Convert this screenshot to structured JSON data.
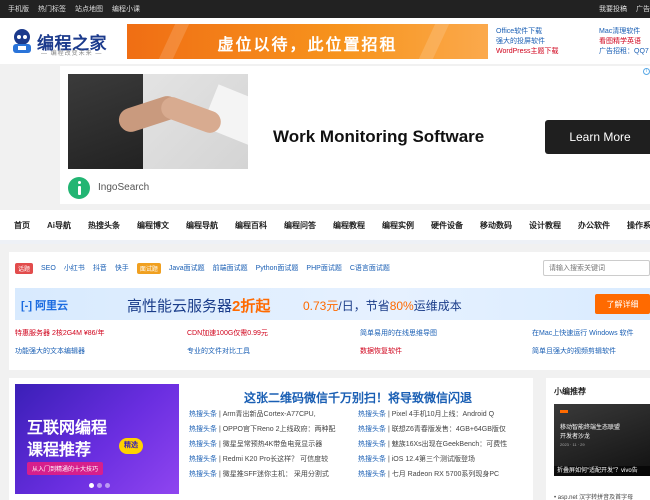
{
  "colors": {
    "brand": "#1b3a8c",
    "link": "#1a5fb4",
    "accent": "#f7941d",
    "red": "#d0021b"
  },
  "topbar": {
    "left": [
      "手机版",
      "热门标签",
      "站点地图",
      "编程小课"
    ],
    "right": [
      "我要投稿",
      "广告"
    ]
  },
  "header": {
    "logo_name": "编程之家",
    "logo_slogan": "— 编程改变未来 —",
    "banner_text": "虚位以待，此位置招租",
    "links_col1": [
      "Office软件下载",
      "强大的投屏软件",
      "WordPress主题下载"
    ],
    "links_col2": [
      "Mac清理软件",
      "看图精学英语",
      "广告招租：QQ7"
    ]
  },
  "ad": {
    "headline": "Work Monitoring Software",
    "button": "Learn More",
    "brand": "IngoSearch",
    "info_icon": "i"
  },
  "nav": [
    "首页",
    "Ai导航",
    "热搜头条",
    "编程博文",
    "编程导航",
    "编程百科",
    "编程问答",
    "编程教程",
    "编程实例",
    "硬件设备",
    "移动数码",
    "设计教程",
    "办公软件",
    "操作系统"
  ],
  "tags": {
    "badge1": "话题",
    "group1": [
      "SEO",
      "小红书",
      "抖音",
      "快手"
    ],
    "badge2": "面试题",
    "group2": [
      "Java面试题",
      "前端面试题",
      "Python面试题",
      "PHP面试题",
      "C语言面试题"
    ],
    "search_placeholder": "请输入搜索关键词"
  },
  "aliyun": {
    "logo": "阿里云",
    "main_a": "高性能云服务器",
    "main_b": "2折起",
    "price_a": "0.73元",
    "price_b": "/日，节省",
    "price_c": "80%",
    "price_d": "运维成本",
    "button": "了解详细"
  },
  "links": {
    "r1": [
      "特惠服务器 2核2G4M ¥86/年",
      "CDN加速100G仅需0.99元",
      "简单易用的在线思维导图",
      "在Mac上快速运行 Windows 软件"
    ],
    "r2": [
      "功能强大的文本编辑器",
      "专业的文件对比工具",
      "数据恢复软件",
      "简单且强大的视频剪辑软件"
    ]
  },
  "promo": {
    "line1": "互联网编程",
    "line2": "课程推荐",
    "badge": "精选",
    "line3": "从入门到精通的十大技巧"
  },
  "news": {
    "headline": "这张二维码微信千万别扫！将导致微信闪退",
    "category": "热搜头条",
    "left": [
      "Arm青出新品Cortex-A77CPU,",
      "OPPO官下Reno 2上线政府：两种配",
      "微星呈常预热4K带鱼电竞显示器",
      "Redmi K20 Pro长这样？ 可信度较",
      "微星推SFF迷你主机： 采用分割式"
    ],
    "right": [
      "Pixel 4手机10月上线：Android Q",
      "联想Z6青春版发售：4GB+64GB版仅",
      "魅族16Xs出现在GeekBench：可费性",
      "iOS 12.4第三个测试版登场",
      "七月 Radeon RX 5700系列现身PC"
    ]
  },
  "side": {
    "title": "小编推荐",
    "thumb_l1": "移动智能终端生态联盟",
    "thumb_l2": "开发者沙龙",
    "thumb_date": "2023 · 11 · 29",
    "caption": "折叠屏如何“适配开发”？vivo告",
    "item": "• asp.net 汉字转拼音及首字母"
  }
}
